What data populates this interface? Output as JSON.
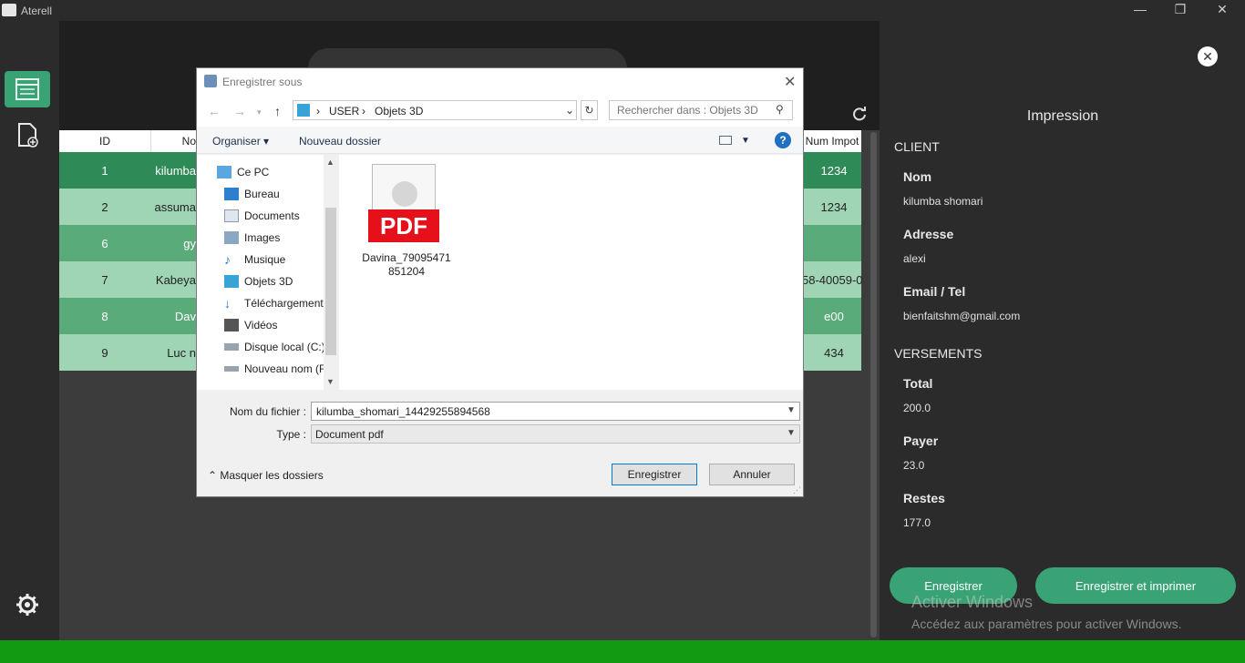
{
  "window": {
    "title": "Aterell",
    "controls": [
      "—",
      "❐",
      "✕"
    ]
  },
  "sidebar": {
    "items": [
      {
        "icon": "table-list-icon",
        "active": true
      },
      {
        "icon": "add-document-icon"
      }
    ],
    "settings_icon": "gear-icon"
  },
  "table": {
    "headers": [
      "ID",
      "No",
      "Num Impot"
    ],
    "rows": [
      {
        "id": "1",
        "name": "kilumba",
        "num": "1234"
      },
      {
        "id": "2",
        "name": "assuma",
        "num": "1234"
      },
      {
        "id": "6",
        "name": "gy",
        "num": ""
      },
      {
        "id": "7",
        "name": "Kabeya",
        "num": "58-40059-0"
      },
      {
        "id": "8",
        "name": "Dav",
        "num": "e00"
      },
      {
        "id": "9",
        "name": "Luc n",
        "num": "434"
      }
    ]
  },
  "dialog": {
    "title": "Enregistrer sous",
    "breadcrumb": [
      "USER",
      "Objets 3D"
    ],
    "search_placeholder": "Rechercher dans : Objets 3D",
    "toolbar": {
      "organize": "Organiser",
      "new_folder": "Nouveau dossier"
    },
    "nav_items": [
      "Ce PC",
      "Bureau",
      "Documents",
      "Images",
      "Musique",
      "Objets 3D",
      "Téléchargements",
      "Vidéos",
      "Disque local (C:)",
      "Nouveau nom (F"
    ],
    "file": {
      "badge": "PDF",
      "name": "Davina_79095471851204"
    },
    "filename_label": "Nom du fichier :",
    "filename_value": "kilumba_shomari_14429255894568",
    "type_label": "Type :",
    "type_value": "Document pdf",
    "hide_folders": "Masquer les dossiers",
    "save_button": "Enregistrer",
    "cancel_button": "Annuler"
  },
  "panel": {
    "title": "Impression",
    "client_section": "CLIENT",
    "nom_label": "Nom",
    "nom_value": "kilumba shomari",
    "adresse_label": "Adresse",
    "adresse_value": "alexi",
    "email_label": "Email / Tel",
    "email_value": "bienfaitshm@gmail.com",
    "versements_section": "VERSEMENTS",
    "total_label": "Total",
    "total_value": "200.0",
    "payer_label": "Payer",
    "payer_value": "23.0",
    "restes_label": "Restes",
    "restes_value": "177.0",
    "save_button": "Enregistrer",
    "save_print_button": "Enregistrer et imprimer"
  },
  "watermark": {
    "line1": "Activer Windows",
    "line2": "Accédez aux paramètres pour activer Windows."
  },
  "colors": {
    "accent_green": "#3aa376",
    "row_dark": "#2e8b57",
    "row_mid": "#5aab7a",
    "row_light": "#9fd4b4",
    "taskbar": "#139a13"
  }
}
